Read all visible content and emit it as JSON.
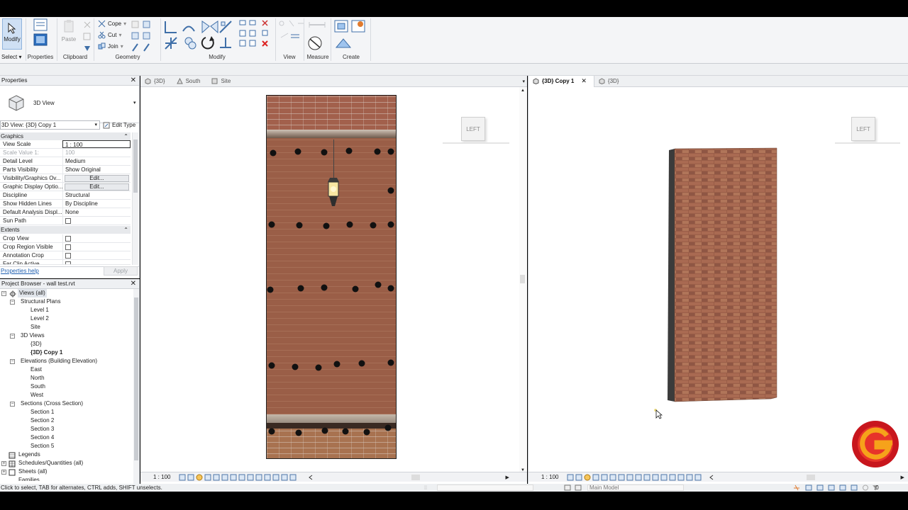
{
  "ribbon": {
    "select": {
      "label": "Modify",
      "dropdown": "Select"
    },
    "properties": {
      "label": "Properties"
    },
    "clipboard": {
      "paste": "Paste",
      "label": "Clipboard"
    },
    "geometry": {
      "cope": "Cope",
      "cut": "Cut",
      "join": "Join",
      "label": "Geometry"
    },
    "modify": {
      "label": "Modify"
    },
    "view": {
      "label": "View"
    },
    "measure": {
      "label": "Measure"
    },
    "create": {
      "label": "Create"
    }
  },
  "properties": {
    "title": "Properties",
    "type_name": "3D View",
    "instance_selector": "3D View: {3D} Copy 1",
    "edit_type": "Edit Type",
    "sections": {
      "graphics": "Graphics",
      "extents": "Extents"
    },
    "rows": [
      {
        "key": "View Scale",
        "value": "1 : 100"
      },
      {
        "key": "Scale Value 1:",
        "value": "100"
      },
      {
        "key": "Detail Level",
        "value": "Medium"
      },
      {
        "key": "Parts Visibility",
        "value": "Show Original"
      },
      {
        "key": "Visibility/Graphics Ov...",
        "value": "Edit..."
      },
      {
        "key": "Graphic Display Optio...",
        "value": "Edit..."
      },
      {
        "key": "Discipline",
        "value": "Structural"
      },
      {
        "key": "Show Hidden Lines",
        "value": "By Discipline"
      },
      {
        "key": "Default Analysis Displ...",
        "value": "None"
      },
      {
        "key": "Sun Path",
        "value": ""
      }
    ],
    "extents_rows": [
      "Crop View",
      "Crop Region Visible",
      "Annotation Crop",
      "Far Clip Active"
    ],
    "help_link": "Properties help",
    "apply": "Apply"
  },
  "browser": {
    "title": "Project Browser - wall test.rvt",
    "tree": {
      "views_all": "Views (all)",
      "structural_plans": "Structural Plans",
      "level1": "Level 1",
      "level2": "Level 2",
      "site": "Site",
      "views_3d": "3D Views",
      "v3d": "{3D}",
      "v3d_copy": "{3D} Copy 1",
      "elevations": "Elevations (Building Elevation)",
      "east": "East",
      "north": "North",
      "south": "South",
      "west": "West",
      "sections": "Sections (Cross Section)",
      "s1": "Section 1",
      "s2": "Section 2",
      "s3": "Section 3",
      "s4": "Section 4",
      "s5": "Section 5",
      "legends": "Legends",
      "schedules": "Schedules/Quantities (all)",
      "sheets": "Sheets (all)",
      "families": "Families"
    }
  },
  "views": {
    "left_tabs": [
      "{3D}",
      "South",
      "Site"
    ],
    "right_tabs": [
      "{3D} Copy 1",
      "{3D}"
    ],
    "viewcube_face": "LEFT",
    "scale_left": "1 : 100",
    "scale_right": "1 : 100"
  },
  "status": {
    "hint": "Click to select, TAB for alternates, CTRL adds, SHIFT unselects.",
    "model": "Main Model",
    "filter_count": ":0"
  }
}
